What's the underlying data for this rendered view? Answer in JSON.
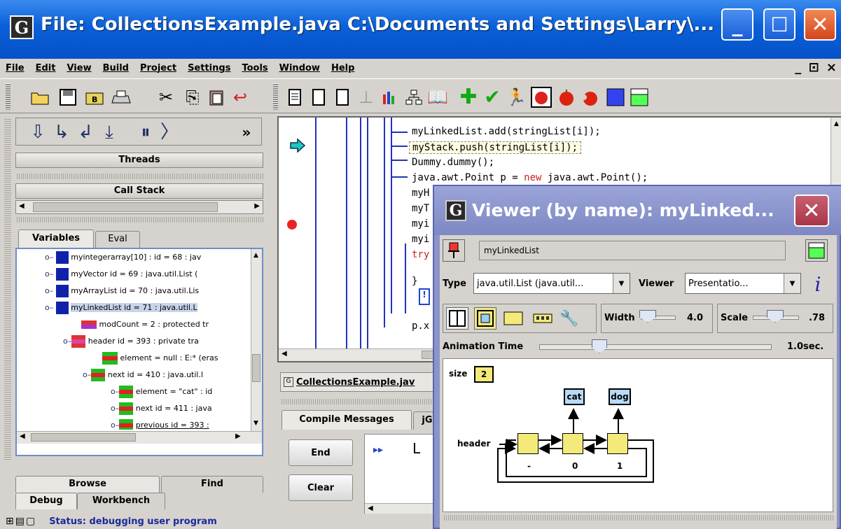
{
  "window": {
    "title": "File: CollectionsExample.java  C:\\Documents and Settings\\Larry\\...",
    "app_letter": "G",
    "min": "_",
    "max": "☐",
    "close": "✕",
    "mdi_controls": "_ ⊡ ×"
  },
  "menu": [
    "File",
    "Edit",
    "View",
    "Build",
    "Project",
    "Settings",
    "Tools",
    "Window",
    "Help"
  ],
  "debug_toolbar": {
    "more": "»"
  },
  "left": {
    "threads": "Threads",
    "call_stack": "Call Stack",
    "tabs": {
      "variables": "Variables",
      "eval": "Eval"
    },
    "tree": [
      "myintegerarray[10] : id = 68 : jav",
      "myVector id = 69 : java.util.List (",
      "myArrayList id = 70 : java.util.Lis",
      "myLinkedList id = 71 : java.util.L",
      "modCount = 2 : protected tr",
      "header id = 393 : private tra",
      "element = null : E:* (eras",
      "next id = 410 : java.util.l",
      "element = \"cat\" : id",
      "next id = 411 : java",
      "previous id = 393 :"
    ],
    "bottom_tabs": {
      "browse": "Browse",
      "find": "Find",
      "debug": "Debug",
      "workbench": "Workbench"
    }
  },
  "code": {
    "lines": [
      "myLinkedList.add(stringList[i]);",
      "myStack.push(stringList[i]);",
      "Dummy.dummy();",
      "java.awt.Point p = ",
      "new",
      " java.awt.Point();",
      "myH",
      "myT",
      "myi",
      "myi",
      "try",
      "}",
      "p.x"
    ],
    "tab_file": "CollectionsExample.jav",
    "compile_tab": "Compile Messages",
    "other_tab": "jG",
    "end_btn": "End",
    "clear_btn": "Clear",
    "console_prompt": "L"
  },
  "viewer": {
    "app_letter": "G",
    "title": "Viewer (by name): myLinked...",
    "close": "✕",
    "name_field": "myLinkedList",
    "type_label": "Type",
    "type_value": "java.util.List (java.util...",
    "viewer_label": "Viewer",
    "viewer_value": "Presentatio...",
    "width_label": "Width",
    "width_value": "4.0",
    "scale_label": "Scale",
    "scale_value": ".78",
    "anim_label": "Animation Time",
    "anim_value": "1.0sec.",
    "anim_level": 0.24,
    "size_label": "size",
    "size_value": "2",
    "header_label": "header",
    "elements": [
      "cat",
      "dog"
    ],
    "indices": [
      "-",
      "0",
      "1"
    ]
  },
  "status": {
    "text": "Status: debugging user program"
  }
}
